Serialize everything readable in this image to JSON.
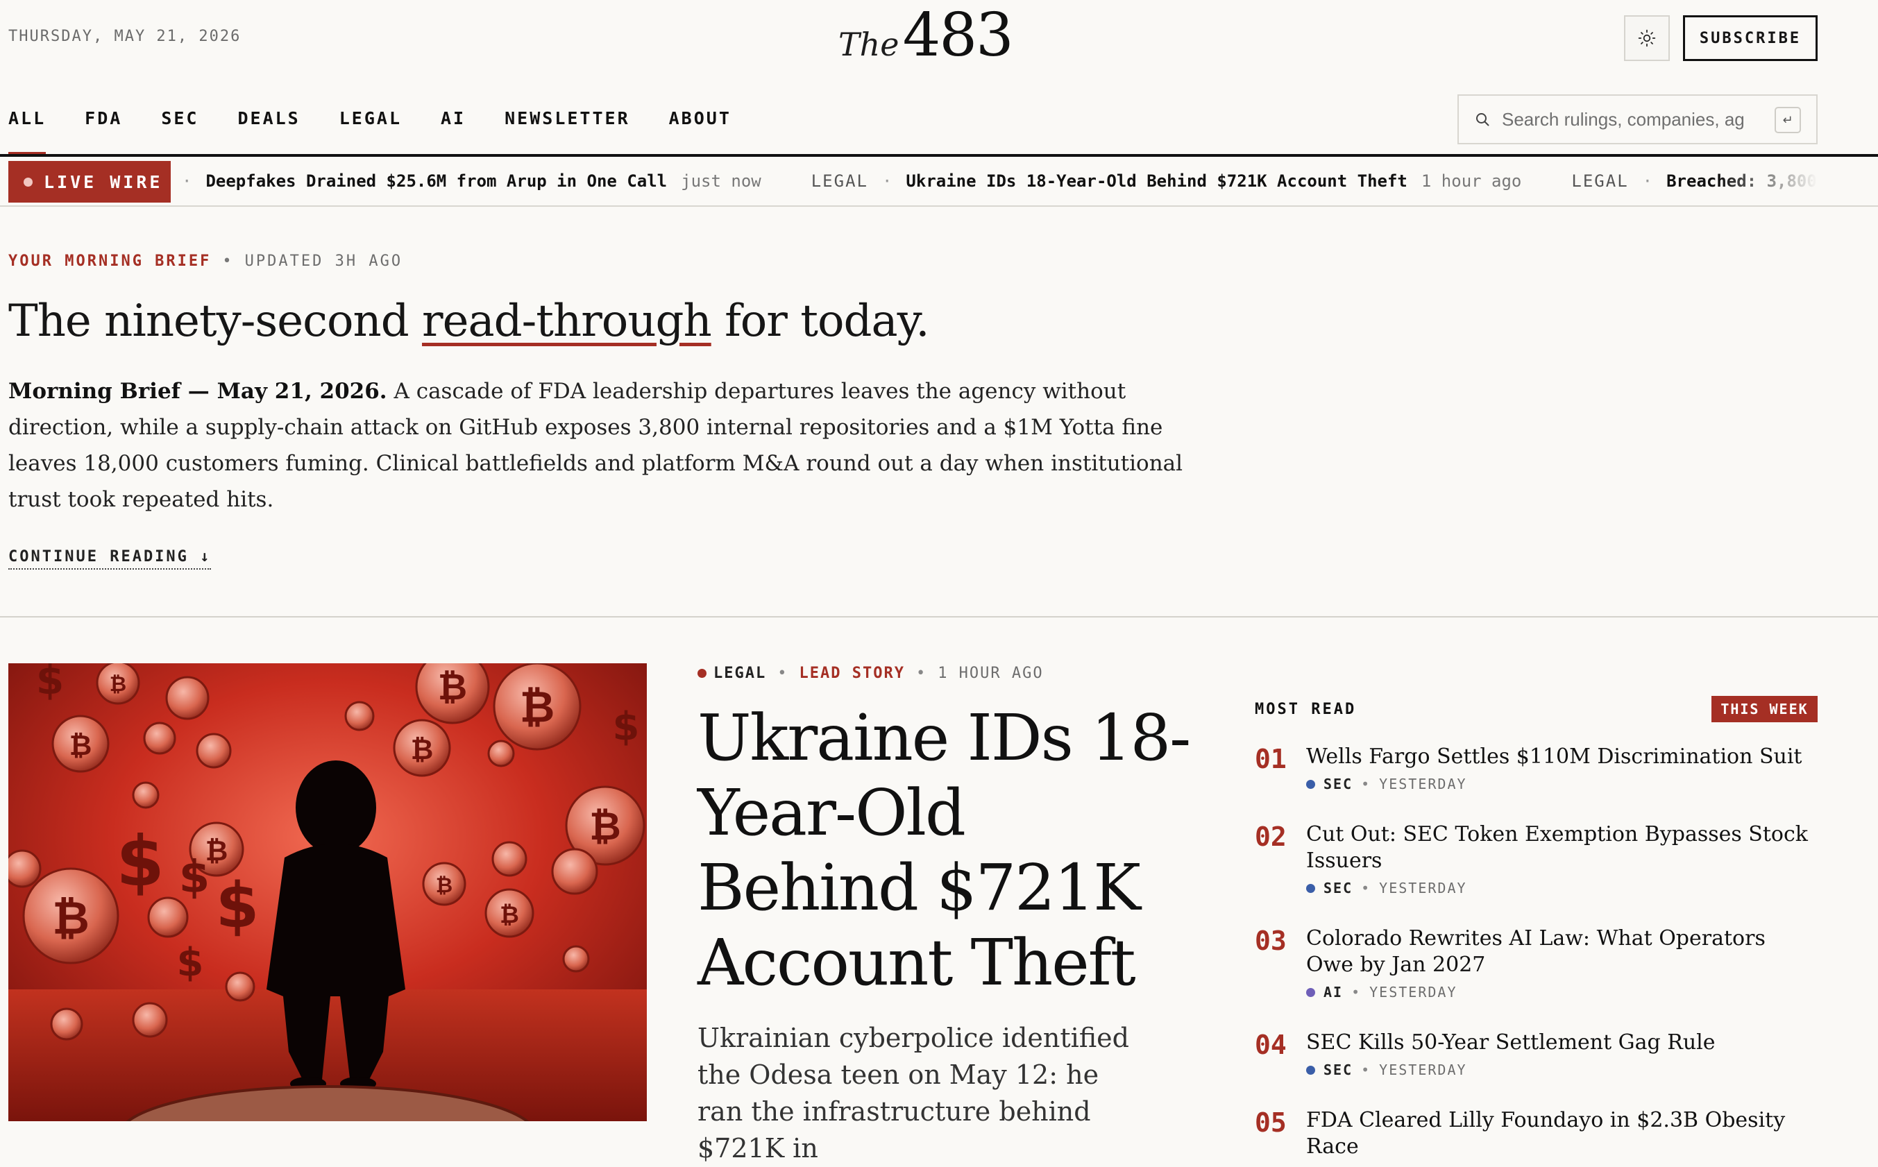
{
  "masthead": {
    "date": "THURSDAY, MAY 21, 2026",
    "logo_prefix": "The",
    "logo_number": "483",
    "subscribe_label": "SUBSCRIBE"
  },
  "nav": {
    "items": [
      {
        "label": "ALL",
        "active": true
      },
      {
        "label": "FDA"
      },
      {
        "label": "SEC"
      },
      {
        "label": "DEALS"
      },
      {
        "label": "LEGAL"
      },
      {
        "label": "AI"
      },
      {
        "label": "NEWSLETTER"
      },
      {
        "label": "ABOUT"
      }
    ],
    "search_placeholder": "Search rulings, companies, ag",
    "search_key": "↵"
  },
  "wire": {
    "label": "LIVE WIRE",
    "items": [
      {
        "category": "",
        "separator": "·",
        "title": "Deepfakes Drained $25.6M from Arup in One Call",
        "time": "just now"
      },
      {
        "category": "LEGAL",
        "separator": "·",
        "title": "Ukraine IDs 18-Year-Old Behind $721K Account Theft",
        "time": "1 hour ago"
      },
      {
        "category": "LEGAL",
        "separator": "·",
        "title": "Breached: 3,800",
        "time": ""
      }
    ]
  },
  "brief": {
    "kicker": "YOUR MORNING BRIEF",
    "updated": "UPDATED 3H AGO",
    "headline_before": "The ninety-second ",
    "headline_highlight": "read-through",
    "headline_after": " for today.",
    "body_lead": "Morning Brief — May 21, 2026.",
    "body": "A cascade of FDA leadership departures leaves the agency without direction, while a supply-chain attack on GitHub exposes 3,800 internal repositories and a $1M Yotta fine leaves 18,000 customers fuming. Clinical battlefields and platform M&A round out a day when institutional trust took repeated hits.",
    "continue_label": "CONTINUE READING ↓"
  },
  "lead": {
    "category": "LEGAL",
    "tag": "LEAD STORY",
    "time": "1 HOUR AGO",
    "headline": "Ukraine IDs 18-Year-Old Behind $721K Account Theft",
    "dek": "Ukrainian cyberpolice identified the Odesa teen on May 12: he ran the infrastructure behind $721K in"
  },
  "most_read": {
    "title": "MOST READ",
    "badge": "THIS WEEK",
    "items": [
      {
        "rank": "01",
        "headline": "Wells Fargo Settles $110M Discrimination Suit",
        "category": "SEC",
        "dot_color": "#3a5ea8",
        "time": "YESTERDAY"
      },
      {
        "rank": "02",
        "headline": "Cut Out: SEC Token Exemption Bypasses Stock Issuers",
        "category": "SEC",
        "dot_color": "#3a5ea8",
        "time": "YESTERDAY"
      },
      {
        "rank": "03",
        "headline": "Colorado Rewrites AI Law: What Operators Owe by Jan 2027",
        "category": "AI",
        "dot_color": "#6f5fb8",
        "time": "YESTERDAY"
      },
      {
        "rank": "04",
        "headline": "SEC Kills 50-Year Settlement Gag Rule",
        "category": "SEC",
        "dot_color": "#3a5ea8",
        "time": "YESTERDAY"
      },
      {
        "rank": "05",
        "headline": "FDA Cleared Lilly Foundayo in $2.3B Obesity Race",
        "category": "",
        "dot_color": "",
        "time": ""
      }
    ]
  },
  "colors": {
    "accent": "#a52f24",
    "background": "#faf9f6",
    "ink": "#161616"
  }
}
